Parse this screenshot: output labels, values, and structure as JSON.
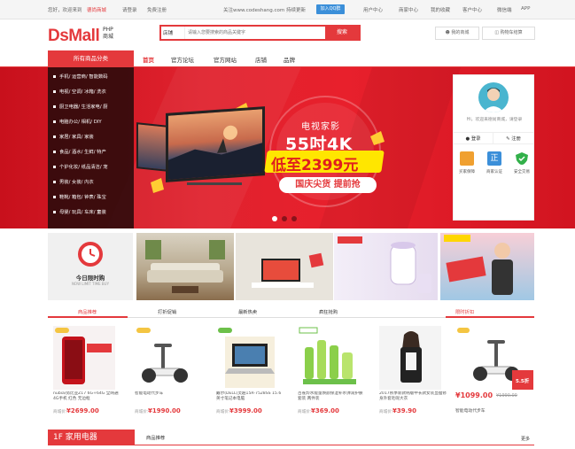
{
  "topbar": {
    "greeting": "您好，欢迎来到",
    "site_name": "德尚商城",
    "login": "请登录",
    "register": "免费注册",
    "follow_text": "关注www.codeshang.com 持续更新",
    "qq_group": "加入QQ群",
    "links": [
      "用户中心",
      "商家中心",
      "我的收藏",
      "客户中心",
      "微信端",
      "APP"
    ]
  },
  "header": {
    "logo": "DsMall",
    "logo_sub_1": "PHP",
    "logo_sub_2": "商城",
    "search_scope": "店铺",
    "search_placeholder": "请输入您要搜索的商品关键字",
    "search_button": "搜索",
    "my_mall": "我的商城",
    "cart": "购物车结算"
  },
  "nav": {
    "all_categories": "所有商品分类",
    "items": [
      "首页",
      "官方论坛",
      "官方网站",
      "店铺",
      "品牌"
    ]
  },
  "categories": [
    "手机/ 运营商/ 智能数码",
    "电视/ 空调/ 冰箱/ 洗衣",
    "厨卫电器/ 生活家电/ 厨",
    "电脑办公/ 相机/ DIY",
    "家居/ 家具/ 家装",
    "食品/ 酒水/ 生鲜/ 特产",
    "个护化妆/ 纸品清洁/ 宠",
    "男装/ 女装/ 内衣",
    "鞋靴/ 箱包/ 钟表/ 珠宝",
    "母婴/ 玩具/ 车床/ 童装"
  ],
  "banner": {
    "line1": "电视家影",
    "line2": "55吋4K",
    "line3": "低至2399元",
    "button": "国庆尖货 提前抢",
    "dots": 3
  },
  "user_panel": {
    "welcome": "Hi，欢迎来德尚商城，请登录",
    "login": "登录",
    "register": "注册",
    "badges": [
      "买家保障",
      "商家认证",
      "安全交易"
    ]
  },
  "features": {
    "today_title": "今日限时购",
    "today_sub": "NOW LIMIT TIME BUY"
  },
  "product_tabs": [
    "商品推荐",
    "打折促销",
    "最新热卖",
    "疯狂抢购",
    "限时折扣"
  ],
  "products": [
    {
      "name": "nubia/努比亚Z17 6G+64G 全网通4G手机 红色 无边框",
      "price_label": "商城价：",
      "price": "¥2699.00"
    },
    {
      "name": "智能电动代步车",
      "price_label": "商城价：",
      "price": "¥1990.00"
    },
    {
      "name": "戴尔(DELL)灵越15R-7528SS 15.6英寸笔记本电脑",
      "price_label": "商城价：",
      "price": "¥3999.00"
    },
    {
      "name": "百雀羚水能量焕颜保湿补水弹润护肤套装 两件装",
      "price_label": "商城价：",
      "price": "¥369.00"
    },
    {
      "name": "2017秋季新款韩版中长款女装显瘦修身外套毛呢大衣",
      "price_label": "商城价：",
      "price": "¥39.90"
    },
    {
      "name": "智能电动代步车",
      "price": "¥1099.00",
      "old_price": "¥1990.00",
      "discount": "5.5折"
    }
  ],
  "floor": {
    "title": "1F 家用电器",
    "tab": "商品推荐",
    "more": "更多"
  },
  "colors": {
    "brand_red": "#e4393c",
    "banner_red": "#e0222e",
    "yellow": "#ffe600"
  }
}
